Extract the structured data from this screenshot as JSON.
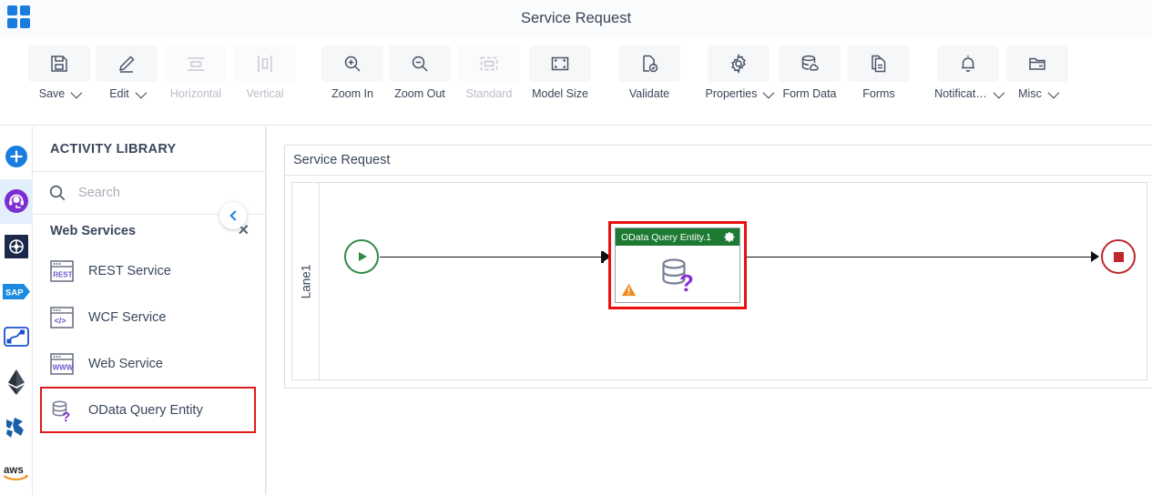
{
  "window": {
    "title": "Service Request",
    "logo_icon": "grid-apps-icon",
    "brand_color": "#1b7ce0"
  },
  "toolbar": {
    "items": [
      {
        "label": "Save",
        "icon": "save-floppy-icon",
        "dropdown": true,
        "disabled": false
      },
      {
        "label": "Edit",
        "icon": "pencil-edit-icon",
        "dropdown": true,
        "disabled": false
      },
      {
        "label": "Horizontal",
        "icon": "align-horizontal-icon",
        "dropdown": false,
        "disabled": true
      },
      {
        "label": "Vertical",
        "icon": "align-vertical-icon",
        "dropdown": false,
        "disabled": true
      },
      {
        "label": "Zoom In",
        "icon": "zoom-in-icon",
        "dropdown": false,
        "disabled": false
      },
      {
        "label": "Zoom Out",
        "icon": "zoom-out-icon",
        "dropdown": false,
        "disabled": false
      },
      {
        "label": "Standard",
        "icon": "standard-size-icon",
        "dropdown": false,
        "disabled": true
      },
      {
        "label": "Model Size",
        "icon": "model-size-icon",
        "dropdown": false,
        "disabled": false
      },
      {
        "label": "Validate",
        "icon": "validate-check-icon",
        "dropdown": false,
        "disabled": false
      },
      {
        "label": "Properties",
        "icon": "gear-properties-icon",
        "dropdown": true,
        "disabled": false
      },
      {
        "label": "Form Data",
        "icon": "database-cloud-icon",
        "dropdown": false,
        "disabled": false
      },
      {
        "label": "Forms",
        "icon": "document-forms-icon",
        "dropdown": false,
        "disabled": false
      },
      {
        "label": "Notificat…",
        "icon": "bell-notification-icon",
        "dropdown": true,
        "disabled": false
      },
      {
        "label": "Misc",
        "icon": "folder-misc-icon",
        "dropdown": true,
        "disabled": false
      }
    ]
  },
  "rail": {
    "items": [
      {
        "name": "add-new-icon",
        "active": false
      },
      {
        "name": "support-agent-icon",
        "active": true
      },
      {
        "name": "connector-hub-icon",
        "active": false
      },
      {
        "name": "sap-icon",
        "active": false
      },
      {
        "name": "workflow-flow-icon",
        "active": false
      },
      {
        "name": "ethereum-icon",
        "active": false
      },
      {
        "name": "azure-icon",
        "active": false
      },
      {
        "name": "aws-icon",
        "active": false
      }
    ]
  },
  "panel": {
    "title": "ACTIVITY LIBRARY",
    "search_placeholder": "Search",
    "search_value": "",
    "search_icon": "search-icon",
    "group": {
      "label": "Web Services",
      "close_icon": "close-icon"
    },
    "activities": [
      {
        "label": "REST Service",
        "icon": "rest-service-icon",
        "selected": false
      },
      {
        "label": "WCF Service",
        "icon": "wcf-service-icon",
        "selected": false
      },
      {
        "label": "Web Service",
        "icon": "web-service-icon",
        "selected": false
      },
      {
        "label": "OData Query Entity",
        "icon": "odata-query-icon",
        "selected": true
      }
    ],
    "collapse_icon": "chevron-left-icon",
    "selection_color": "#e01b1b"
  },
  "canvas": {
    "diagram_title": "Service Request",
    "lane_label": "Lane1",
    "start_node": {
      "name": "start-event",
      "color": "#2e8b45"
    },
    "end_node": {
      "name": "end-event",
      "color": "#c0272d"
    },
    "task": {
      "title": "OData Query Entity.1",
      "header_color": "#1d7a33",
      "selection_color": "#e8110e",
      "settings_icon": "gear-icon",
      "body_icon": "odata-query-icon",
      "warning_icon": "warning-triangle-icon"
    }
  }
}
